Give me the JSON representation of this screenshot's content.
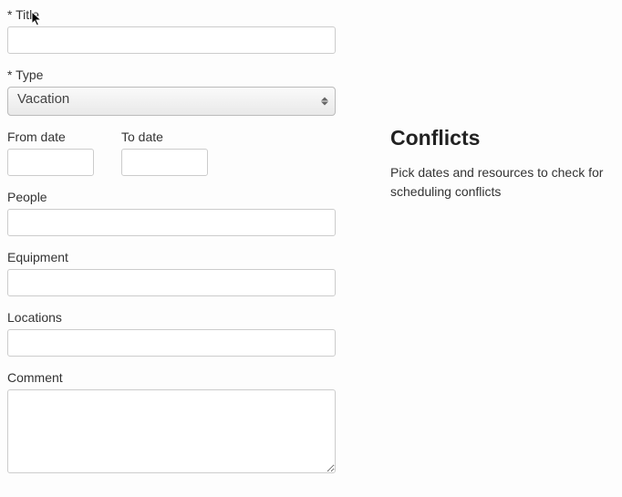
{
  "form": {
    "title": {
      "label": "* Title",
      "value": ""
    },
    "type": {
      "label": "* Type",
      "selected": "Vacation"
    },
    "from_date": {
      "label": "From date",
      "value": ""
    },
    "to_date": {
      "label": "To date",
      "value": ""
    },
    "people": {
      "label": "People",
      "value": ""
    },
    "equipment": {
      "label": "Equipment",
      "value": ""
    },
    "locations": {
      "label": "Locations",
      "value": ""
    },
    "comment": {
      "label": "Comment",
      "value": ""
    }
  },
  "sidebar": {
    "heading": "Conflicts",
    "description": "Pick dates and resources to check for scheduling conflicts"
  }
}
